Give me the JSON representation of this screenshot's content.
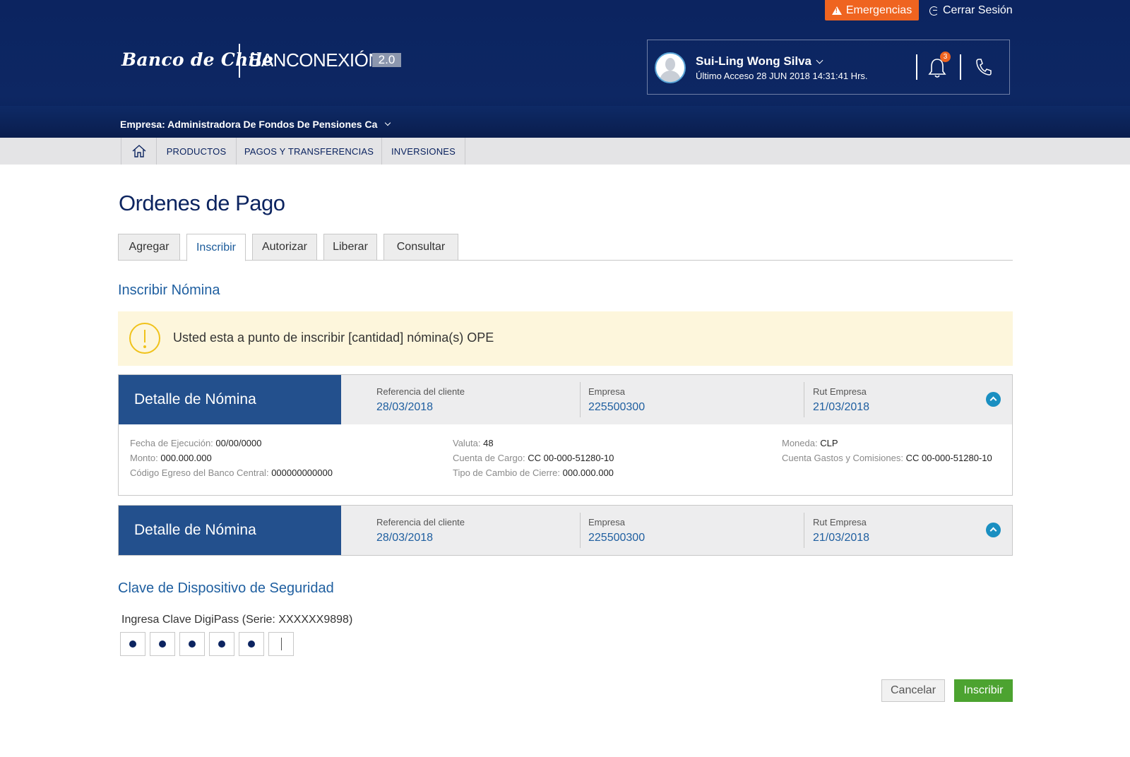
{
  "header": {
    "emergency_label": "Emergencias",
    "logout_label": "Cerrar Sesión",
    "logo_bank": "Banco de Chile",
    "logo_product": "BANCONEXIÓN",
    "logo_version": "2.0",
    "user_name": "Sui-Ling Wong Silva",
    "last_access": "Último Acceso 28 JUN 2018 14:31:41 Hrs.",
    "notification_count": "3",
    "company_selector": "Empresa: Administradora De Fondos De Pensiones Ca"
  },
  "nav": {
    "home_icon": "home-icon",
    "items": [
      "PRODUCTOS",
      "PAGOS Y TRANSFERENCIAS",
      "INVERSIONES"
    ]
  },
  "page": {
    "title": "Ordenes de Pago",
    "tabs": [
      "Agregar",
      "Inscribir",
      "Autorizar",
      "Liberar",
      "Consultar"
    ],
    "active_tab": "Inscribir",
    "section_title": "Inscribir Nómina",
    "alert_text": "Usted esta a punto de inscribir [cantidad] nómina(s) OPE"
  },
  "cards": [
    {
      "title": "Detalle de Nómina",
      "ref_label": "Referencia del cliente",
      "ref_value": "28/03/2018",
      "empresa_label": "Empresa",
      "empresa_value": "225500300",
      "rut_label": "Rut Empresa",
      "rut_value": "21/03/2018",
      "expanded": true,
      "details": {
        "fecha_label": "Fecha de Ejecución:",
        "fecha_value": "00/00/0000",
        "monto_label": "Monto:",
        "monto_value": "000.000.000",
        "codigo_label": "Código Egreso del Banco Central:",
        "codigo_value": "000000000000",
        "valuta_label": "Valuta:",
        "valuta_value": "48",
        "cuenta_cargo_label": "Cuenta de Cargo:",
        "cuenta_cargo_value": "CC 00-000-51280-10",
        "tipo_cambio_label": "Tipo de Cambio de Cierre:",
        "tipo_cambio_value": "000.000.000",
        "moneda_label": "Moneda:",
        "moneda_value": "CLP",
        "cuenta_gastos_label": "Cuenta Gastos y Comisiones:",
        "cuenta_gastos_value": "CC 00-000-51280-10"
      }
    },
    {
      "title": "Detalle de Nómina",
      "ref_label": "Referencia del cliente",
      "ref_value": "28/03/2018",
      "empresa_label": "Empresa",
      "empresa_value": "225500300",
      "rut_label": "Rut Empresa",
      "rut_value": "21/03/2018",
      "expanded": false
    }
  ],
  "security": {
    "title": "Clave de Dispositivo de Seguridad",
    "label": "Ingresa Clave DigiPass (Serie: XXXXXX9898)",
    "digits_filled": 5,
    "digits_total": 6
  },
  "actions": {
    "cancel_label": "Cancelar",
    "submit_label": "Inscribir"
  },
  "colors": {
    "header_bg": "#0c2460",
    "accent_orange": "#ef6420",
    "card_title_bg": "#23508d",
    "link_blue": "#1f5fa0",
    "submit_green": "#4ca330"
  }
}
